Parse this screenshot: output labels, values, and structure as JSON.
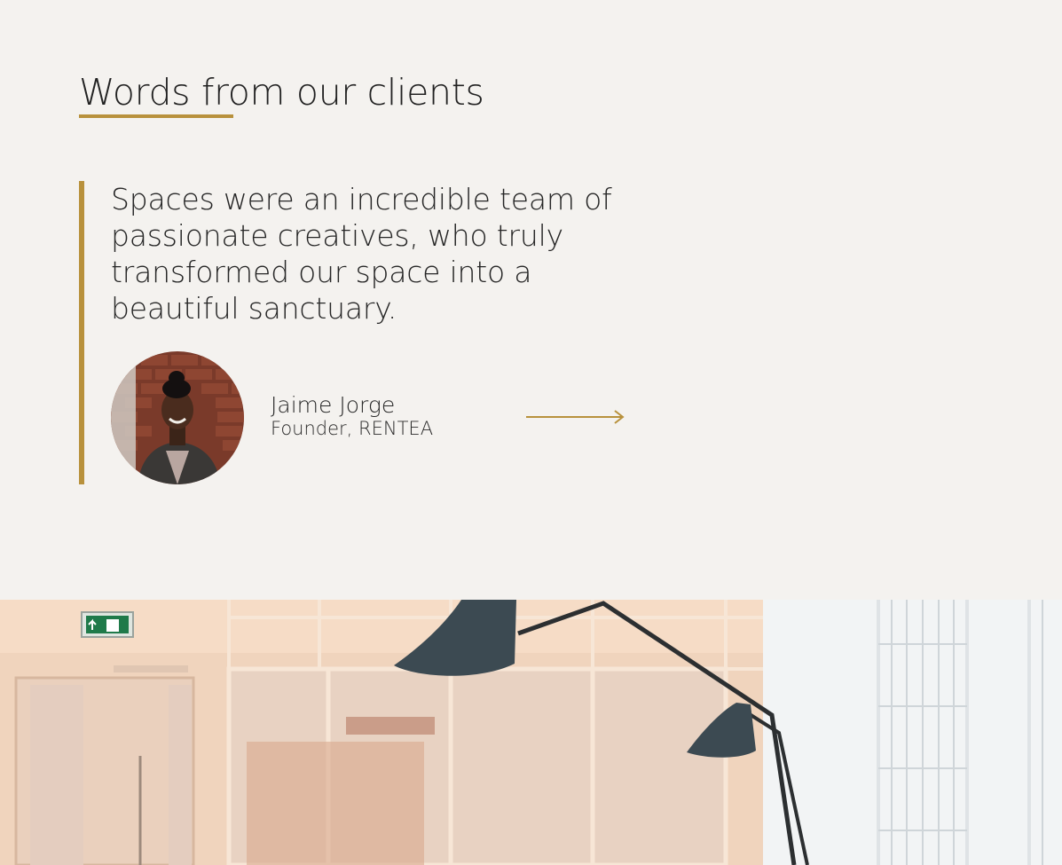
{
  "testimonials": {
    "title": "Words from our clients",
    "quote": "Spaces were an incredible team of passionate creatives, who truly transformed our space into a beautiful sanctuary.",
    "author": {
      "name": "Jaime Jorge",
      "role": "Founder, RENTEA"
    },
    "next_icon": "arrow-right-icon"
  },
  "colors": {
    "accent": "#b8913c",
    "background": "#f4f2ef",
    "text": "#262626"
  }
}
